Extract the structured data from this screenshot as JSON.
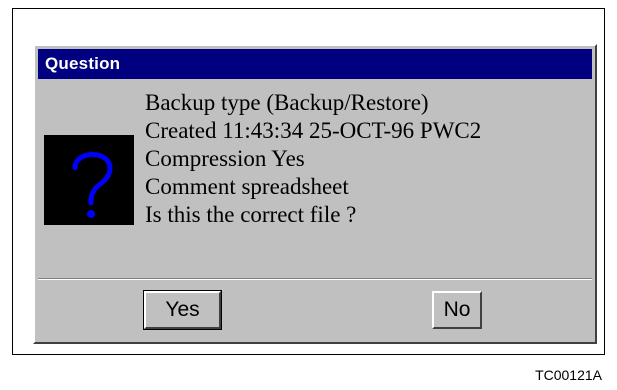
{
  "dialog": {
    "title": "Question",
    "icon": "question-mark-icon",
    "message_lines": [
      "Backup type (Backup/Restore)",
      "Created 11:43:34  25-OCT-96 PWC2",
      "Compression Yes",
      "Comment spreadsheet",
      "Is this the correct file ?"
    ],
    "buttons": {
      "yes_label": "Yes",
      "no_label": "No"
    }
  },
  "figure_id": "TC00121A",
  "colors": {
    "titlebar": "#000080",
    "dialog_face": "#c0c0c0",
    "icon_background": "#000000",
    "icon_glyph": "#0000ff"
  }
}
